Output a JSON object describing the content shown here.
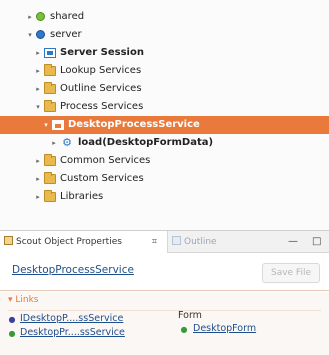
{
  "tree": {
    "items": [
      {
        "label": "shared",
        "icon": "green-dot-icon",
        "expanded": false
      },
      {
        "label": "server",
        "icon": "blue-dot-icon",
        "expanded": true
      },
      {
        "label": "Server Session",
        "icon": "session-icon",
        "expanded": false
      },
      {
        "label": "Lookup Services",
        "icon": "folder-icon",
        "expanded": false
      },
      {
        "label": "Outline Services",
        "icon": "folder-icon",
        "expanded": false
      },
      {
        "label": "Process Services",
        "icon": "folder-icon",
        "expanded": true
      },
      {
        "label": "DesktopProcessService",
        "icon": "service-icon",
        "expanded": true,
        "selected": true
      },
      {
        "label": "load(DesktopFormData)",
        "icon": "operation-icon",
        "expanded": false
      },
      {
        "label": "Common Services",
        "icon": "folder-icon",
        "expanded": false
      },
      {
        "label": "Custom Services",
        "icon": "folder-icon",
        "expanded": false
      },
      {
        "label": "Libraries",
        "icon": "folder-icon",
        "expanded": false
      }
    ]
  },
  "properties_view": {
    "tabs": [
      {
        "label": "Scout Object Properties",
        "active": true
      },
      {
        "label": "Outline",
        "active": false
      }
    ],
    "close_glyph": "⌗",
    "minimize_glyph": "—",
    "maximize_glyph": "□",
    "form_title": "DesktopProcessService",
    "save_button": "Save File",
    "links_section": {
      "header": "▾ Links",
      "links": [
        {
          "label": "IDesktopP....ssService",
          "icon": "interface-icon"
        },
        {
          "label": "DesktopPr....ssService",
          "icon": "class-icon"
        }
      ],
      "form_label": "Form",
      "form_link": "DesktopForm"
    }
  },
  "colors": {
    "selection": "#e97a3c",
    "link": "#1f4e8c",
    "folder": "#e9b94d",
    "section_header": "#e97a3c"
  }
}
